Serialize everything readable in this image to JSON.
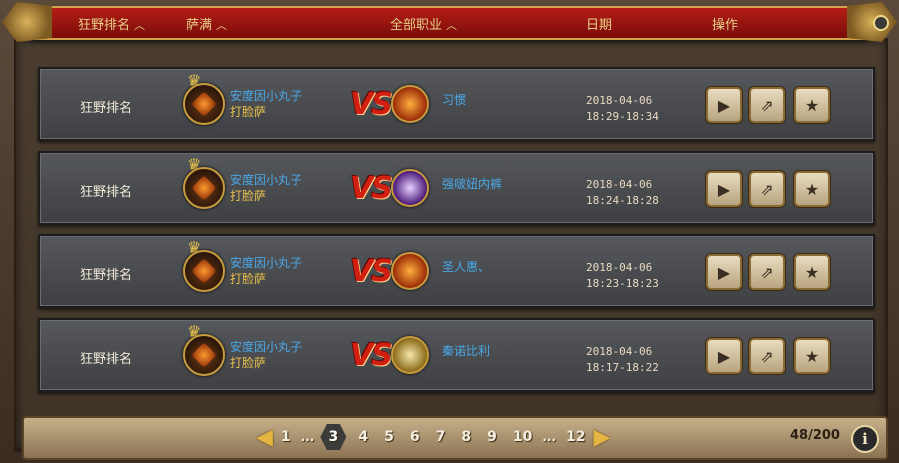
{
  "header": {
    "columns": [
      {
        "label": "狂野排名",
        "sortable": true
      },
      {
        "label": "萨满",
        "sortable": true
      },
      {
        "label": "全部职业",
        "sortable": true
      },
      {
        "label": "日期",
        "sortable": false
      },
      {
        "label": "操作",
        "sortable": false
      }
    ]
  },
  "matches": [
    {
      "mode": "狂野排名",
      "player_name": "安度因小丸子",
      "player_class": "打脸萨",
      "vs": "VS",
      "opponent_name": "习惯",
      "opponent_icon": "mage-fire-icon",
      "date": "2018-04-06",
      "time": "18:29-18:34"
    },
    {
      "mode": "狂野排名",
      "player_name": "安度因小丸子",
      "player_class": "打脸萨",
      "vs": "VS",
      "opponent_name": "强啵妞内裤",
      "opponent_icon": "priest-shadow-icon",
      "date": "2018-04-06",
      "time": "18:24-18:28"
    },
    {
      "mode": "狂野排名",
      "player_name": "安度因小丸子",
      "player_class": "打脸萨",
      "vs": "VS",
      "opponent_name": "圣人惠、",
      "opponent_icon": "mage-fire-icon",
      "date": "2018-04-06",
      "time": "18:23-18:23"
    },
    {
      "mode": "狂野排名",
      "player_name": "安度因小丸子",
      "player_class": "打脸萨",
      "vs": "VS",
      "opponent_name": "秦诺比利",
      "opponent_icon": "paladin-icon",
      "date": "2018-04-06",
      "time": "18:17-18:22"
    }
  ],
  "actions": {
    "play": "play-icon",
    "share": "share-icon",
    "favorite": "star-icon"
  },
  "pagination": {
    "prev": "◀",
    "next": "▶",
    "pages": [
      "1",
      "...",
      "3",
      "4",
      "5",
      "6",
      "7",
      "8",
      "9",
      "10",
      "...",
      "12"
    ],
    "current": "3",
    "count": "48/200"
  },
  "info_label": "i",
  "colors": {
    "header_red": "#9e1510",
    "link_blue": "#4aa8e8",
    "gold": "#e8c04a",
    "vs_red": "#d11f12"
  }
}
